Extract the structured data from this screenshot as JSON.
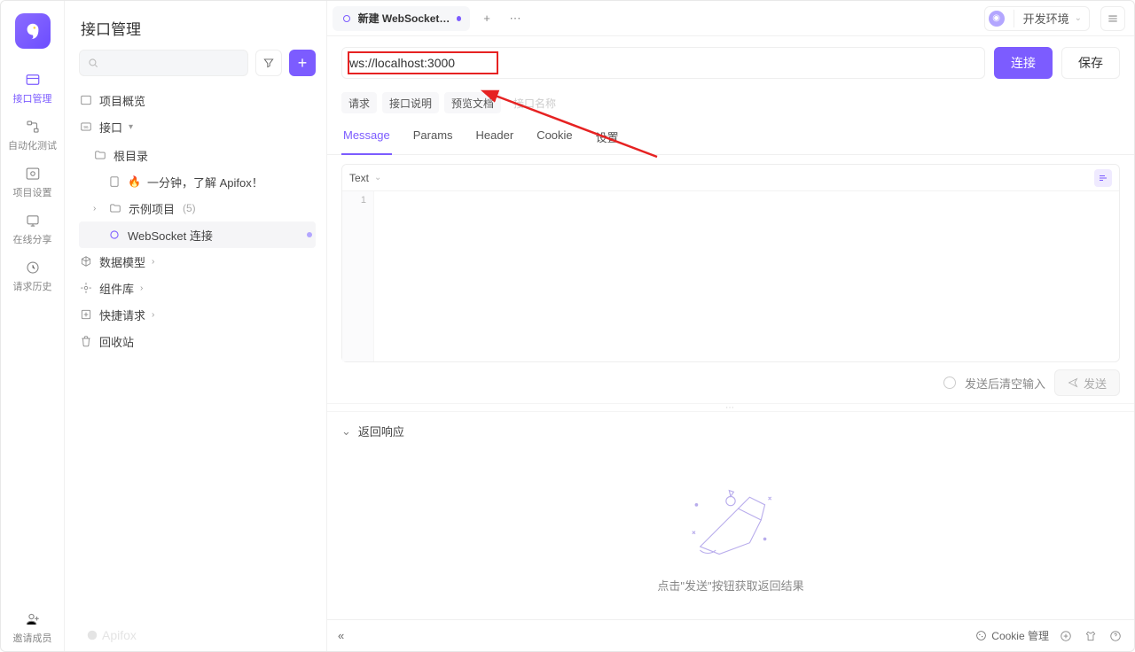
{
  "rail": {
    "items": [
      {
        "label": "接口管理",
        "icon": "api-icon",
        "active": true
      },
      {
        "label": "自动化测试",
        "icon": "flow-icon"
      },
      {
        "label": "项目设置",
        "icon": "settings-icon"
      },
      {
        "label": "在线分享",
        "icon": "share-icon"
      },
      {
        "label": "请求历史",
        "icon": "history-icon"
      }
    ],
    "invite": "邀请成员"
  },
  "sidebar": {
    "title": "接口管理",
    "search_placeholder": "Q",
    "items": {
      "overview": "项目概览",
      "api": "接口",
      "root": "根目录",
      "quickstart": "一分钟，了解 Apifox！",
      "sample": "示例项目",
      "sample_count": "(5)",
      "ws": "WebSocket 连接",
      "datamodel": "数据模型",
      "components": "组件库",
      "quickreq": "快捷请求",
      "trash": "回收站"
    },
    "watermark": "Apifox"
  },
  "header": {
    "tab": {
      "label": "新建 WebSocket 接..."
    },
    "env": "开发环境"
  },
  "url": {
    "value": "ws://localhost:3000",
    "connect": "连接",
    "save": "保存"
  },
  "subtabs1": {
    "req": "请求",
    "doc": "接口说明",
    "preview": "预览文档",
    "name_placeholder": "接口名称"
  },
  "subtabs2": {
    "message": "Message",
    "params": "Params",
    "header": "Header",
    "cookie": "Cookie",
    "settings": "设置"
  },
  "editor": {
    "mode": "Text",
    "line1": "1"
  },
  "sendrow": {
    "clear": "发送后清空输入",
    "send": "发送"
  },
  "response": {
    "title": "返回响应",
    "empty_hint": "点击\"发送\"按钮获取返回结果"
  },
  "footer": {
    "cookie": "Cookie 管理"
  }
}
